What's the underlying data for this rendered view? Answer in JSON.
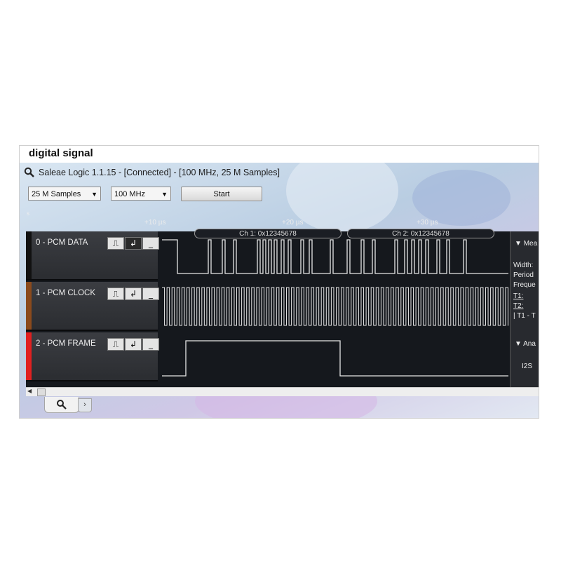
{
  "caption": "digital signal",
  "window": {
    "title": "Saleae Logic 1.1.15 - [Connected] - [100 MHz, 25 M Samples]"
  },
  "toolbar": {
    "samples": "25 M Samples",
    "rate": "100 MHz",
    "start_label": "Start"
  },
  "timeline": {
    "unit": "s",
    "ticks": [
      "+10 µs",
      "+20 µs",
      "+30 µs"
    ]
  },
  "channels": [
    {
      "label": "0 - PCM DATA",
      "color": "#111111"
    },
    {
      "label": "1 - PCM CLOCK",
      "color": "#8b4a1c"
    },
    {
      "label": "2 - PCM FRAME",
      "color": "#e02020"
    }
  ],
  "bus": {
    "ch1": "Ch 1: 0x12345678",
    "ch2": "Ch 2: 0x12345678"
  },
  "side_panel": {
    "measurements_header": "Mea",
    "measure_lines": [
      "Width:",
      "Period",
      "Freque",
      "T1:",
      "T2:",
      "| T1 - T"
    ],
    "analyzers_header": "Ana",
    "analyzer": "I2S"
  },
  "colors": {
    "wave": "#e6e6e6",
    "background": "#15181d"
  }
}
